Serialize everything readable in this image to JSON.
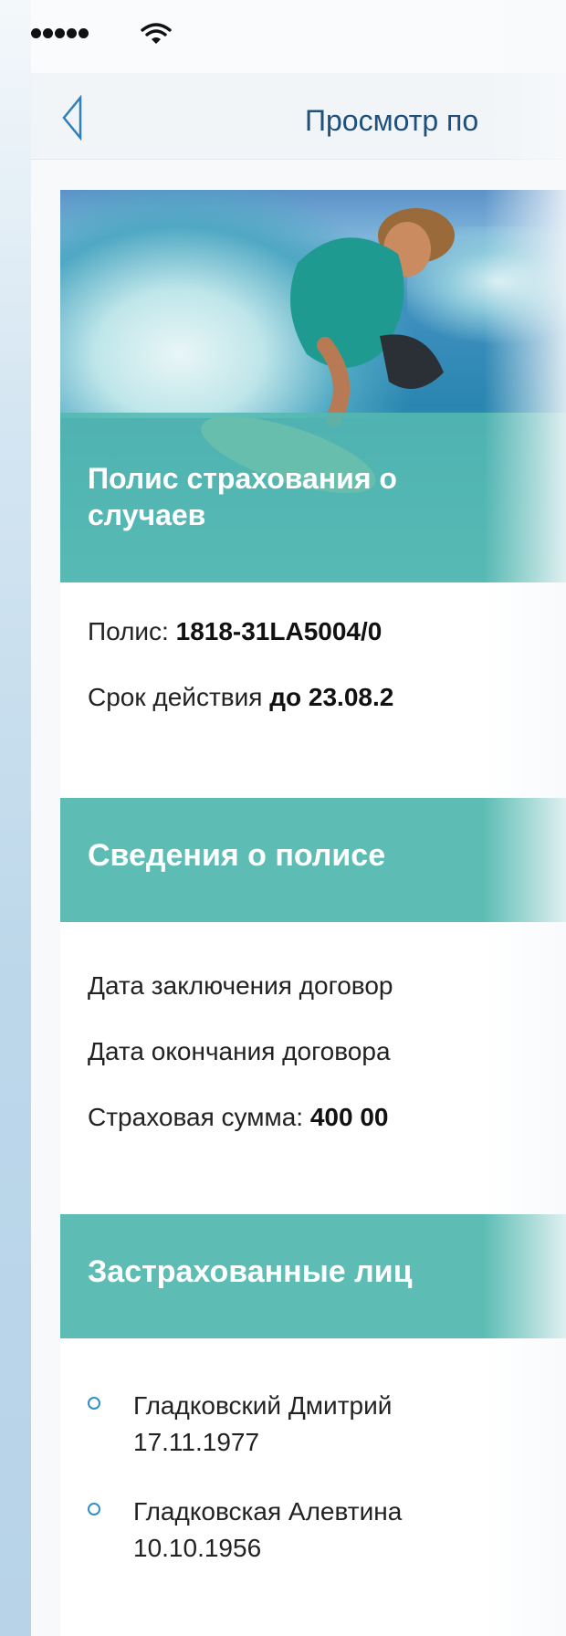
{
  "status_bar": {
    "signal_dots": 5,
    "wifi_icon": "wifi-icon"
  },
  "nav": {
    "back_icon": "chevron-left-icon",
    "title": "Просмотр по"
  },
  "hero": {
    "title_line1": "Полис страхования о",
    "title_line2": "случаев"
  },
  "policy": {
    "number_label": "Полис: ",
    "number_value": "1818-31LA5004/0",
    "validity_label": "Срок действия ",
    "validity_value": "до 23.08.2"
  },
  "sections": {
    "info_title": "Сведения о полисе",
    "insured_title": "Застрахованные лиц"
  },
  "info": {
    "conclusion_date_label": "Дата заключения договор",
    "end_date_label": "Дата окончания договора",
    "sum_label": "Страховая сумма: ",
    "sum_value": "400 00"
  },
  "insured": [
    {
      "name": "Гладковский Дмитрий",
      "date": "17.11.1977"
    },
    {
      "name": "Гладковская Алевтина",
      "date": "10.10.1956"
    }
  ],
  "colors": {
    "accent": "#5dbdb5",
    "nav_text": "#1f4f7a",
    "bullet": "#2e8ec7"
  }
}
